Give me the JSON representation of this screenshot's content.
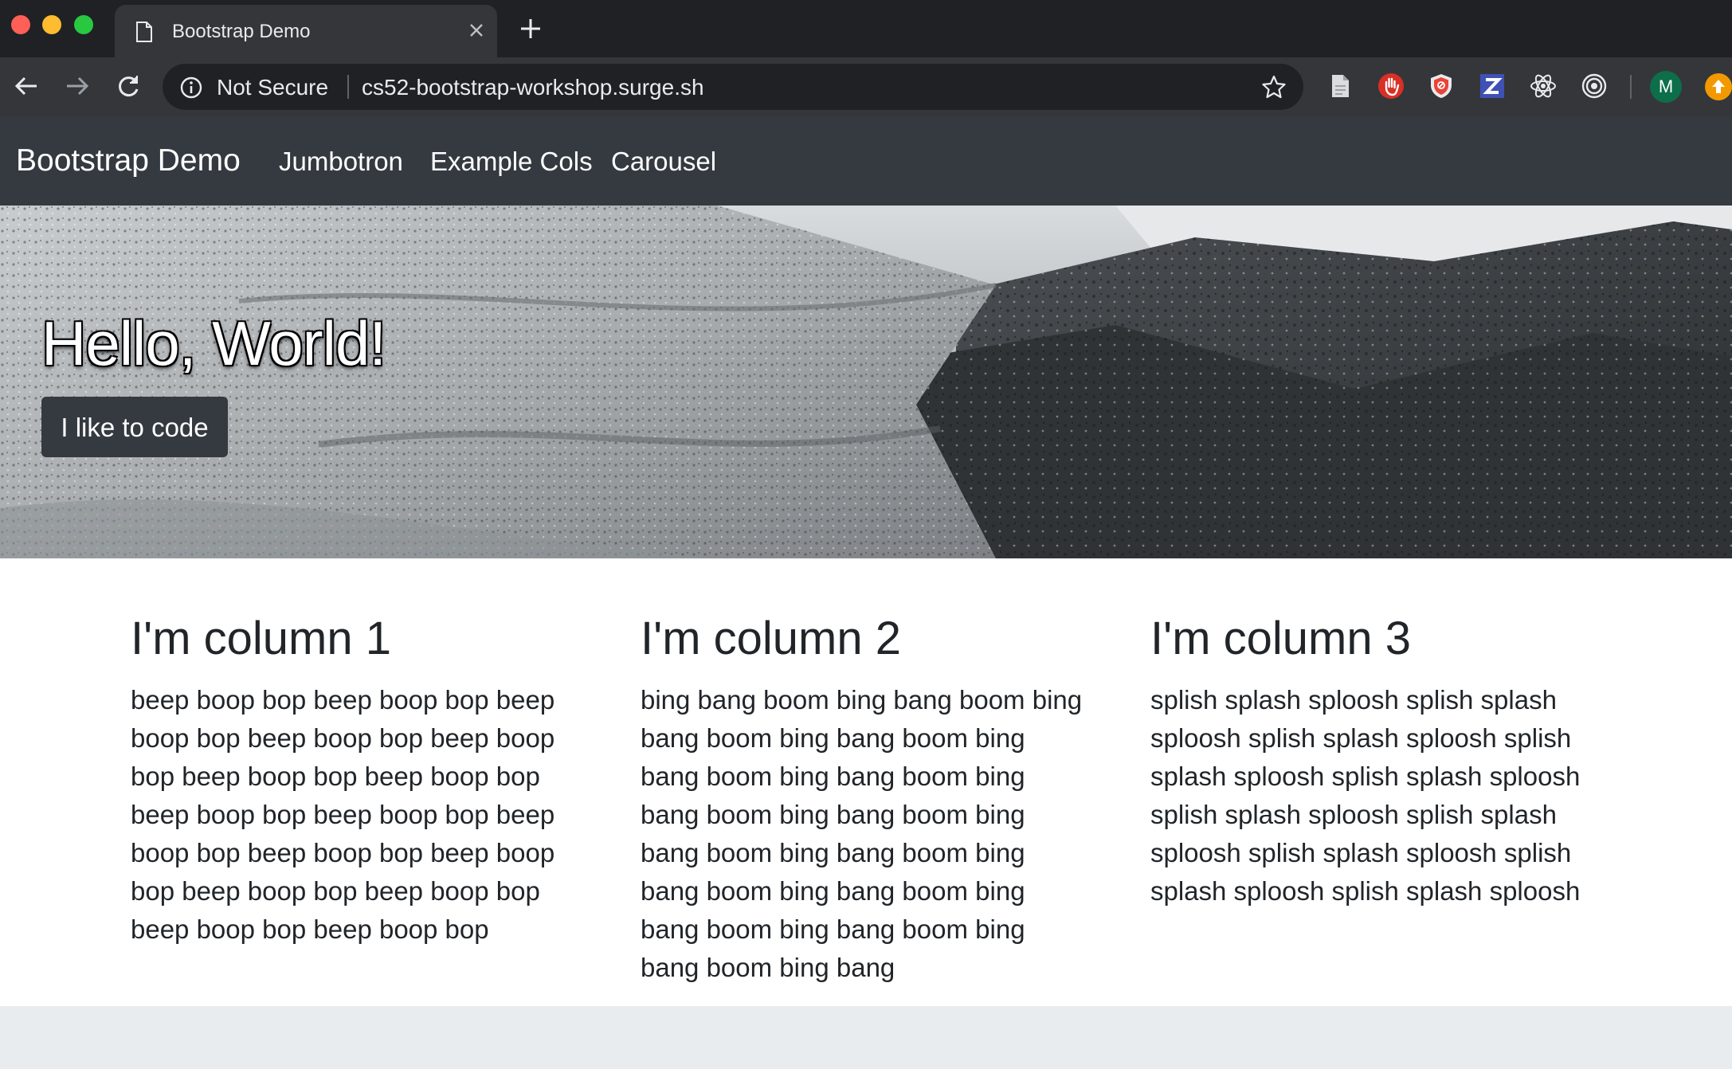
{
  "browser": {
    "tab_title": "Bootstrap Demo",
    "security_label": "Not Secure",
    "url": "cs52-bootstrap-workshop.surge.sh",
    "profile_initial": "M"
  },
  "navbar": {
    "brand": "Bootstrap Demo",
    "links": [
      "Jumbotron",
      "Example Cols",
      "Carousel"
    ]
  },
  "jumbotron": {
    "title": "Hello, World!",
    "button_label": "I like to code"
  },
  "columns": [
    {
      "heading": "I'm column 1",
      "text": "beep boop bop beep boop bop beep boop bop beep boop bop beep boop bop beep boop bop beep boop bop beep boop bop beep boop bop beep boop bop beep boop bop beep boop bop beep boop bop beep boop bop beep boop bop beep boop bop"
    },
    {
      "heading": "I'm column 2",
      "text": "bing bang boom bing bang boom bing bang boom bing bang boom bing bang boom bing bang boom bing bang boom bing bang boom bing bang boom bing bang boom bing bang boom bing bang boom bing bang boom bing bang boom bing bang boom bing bang"
    },
    {
      "heading": "I'm column 3",
      "text": "splish splash sploosh splish splash sploosh splish splash sploosh splish splash sploosh splish splash sploosh splish splash sploosh splish splash sploosh splish splash sploosh splish splash sploosh splish splash sploosh"
    }
  ],
  "colors": {
    "navbar_bg": "#343a40",
    "page_bg": "#e9ecef",
    "text": "#212529"
  }
}
